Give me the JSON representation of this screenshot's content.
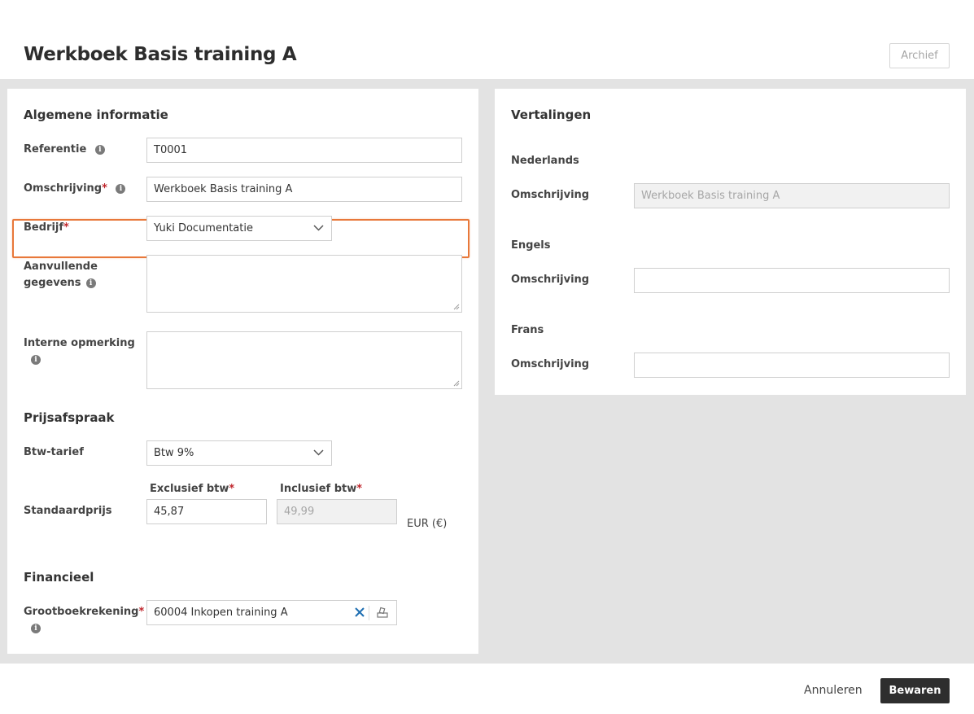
{
  "header": {
    "title": "Werkboek Basis training A",
    "archive_label": "Archief"
  },
  "general": {
    "section_title": "Algemene informatie",
    "reference_label": "Referentie",
    "reference_value": "T0001",
    "description_label": "Omschrijving",
    "description_value": "Werkboek Basis training A",
    "company_label": "Bedrijf",
    "company_value": "Yuki Documentatie",
    "additional_label_line1": "Aanvullende",
    "additional_label_line2": "gegevens",
    "additional_value": "",
    "internal_label": "Interne opmerking",
    "internal_value": "",
    "required_mark": "*",
    "info_glyph": "i"
  },
  "pricing": {
    "section_title": "Prijsafspraak",
    "vat_label": "Btw-tarief",
    "vat_value": "Btw 9%",
    "excl_label": "Exclusief btw",
    "incl_label": "Inclusief btw",
    "standard_price_label": "Standaardprijs",
    "excl_value": "45,87",
    "incl_value": "49,99",
    "currency": "EUR (€)"
  },
  "financial": {
    "section_title": "Financieel",
    "gl_label": "Grootboekrekening",
    "gl_value": "60004 Inkopen training A"
  },
  "translations": {
    "section_title": "Vertalingen",
    "languages": [
      {
        "name": "Nederlands",
        "field_label": "Omschrijving",
        "value": "Werkboek Basis training A",
        "disabled": true
      },
      {
        "name": "Engels",
        "field_label": "Omschrijving",
        "value": "",
        "disabled": false
      },
      {
        "name": "Frans",
        "field_label": "Omschrijving",
        "value": "",
        "disabled": false
      }
    ]
  },
  "footer": {
    "cancel_label": "Annuleren",
    "save_label": "Bewaren"
  },
  "colors": {
    "highlight": "#e8783a",
    "required": "#c0272d",
    "clear_icon": "#1f6fb2",
    "save_button": "#2e2e2e",
    "background": "#e3e3e3"
  },
  "icons": [
    "info-icon",
    "chevron-down-icon",
    "clear-x-icon",
    "lookup-icon",
    "resize-grip-icon"
  ]
}
